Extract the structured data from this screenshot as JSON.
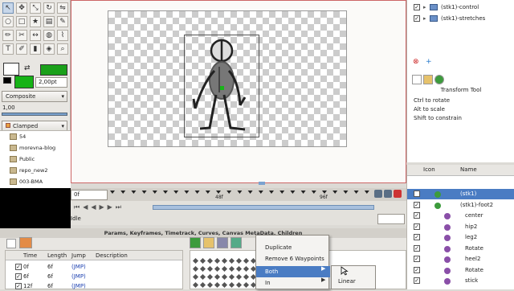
{
  "toolbox": {
    "tools": [
      "arrow",
      "smooth-move",
      "scale",
      "rotate",
      "mirror",
      "circle",
      "rectangle",
      "star",
      "gradient",
      "spline",
      "draw",
      "cutout",
      "width",
      "fill",
      "eyedrop",
      "text",
      "sketch",
      "brush",
      "bone",
      "zoom"
    ],
    "outline_color": "#1aa01a",
    "fill_color": "#16b316",
    "width_value": "2,00pt",
    "blend_method": "Composite",
    "opacity_value": "1,00",
    "interpolation": "Clamped"
  },
  "files": {
    "items": [
      "54",
      "morevna-blog",
      "Public",
      "repo_new2",
      "003-BMA"
    ]
  },
  "layers_top": {
    "rows": [
      {
        "label": "(stk1)-control",
        "checked": true
      },
      {
        "label": "(stk1)-stretches",
        "checked": true
      }
    ]
  },
  "tool_options": {
    "title": "Transform Tool",
    "lines": [
      "Ctrl to rotate",
      "Alt to scale",
      "Shift to constrain"
    ]
  },
  "timebar": {
    "current_frame": "0f",
    "tick_labels": [
      "48f",
      "96f"
    ]
  },
  "status": {
    "text": "Idle"
  },
  "bottom_panel": {
    "title": "Params, Keyframes, Timetrack, Curves, Canvas MetaData, Children",
    "columns": [
      "Time",
      "Length",
      "Jump",
      "Description"
    ],
    "rows": [
      {
        "time": "0f",
        "length": "6f",
        "jump": "(JMP)"
      },
      {
        "time": "6f",
        "length": "6f",
        "jump": "(JMP)"
      },
      {
        "time": "12f",
        "length": "6f",
        "jump": "(JMP)"
      }
    ]
  },
  "context_menu": {
    "items": [
      "Duplicate",
      "Remove 6 Waypoints",
      "Both",
      "In"
    ],
    "highlighted": "Both",
    "submenu": [
      "Linear"
    ]
  },
  "params": {
    "columns": [
      "Icon",
      "Name"
    ],
    "rows": [
      {
        "name": "(stk1)",
        "selected": true
      },
      {
        "name": "(stk1)-foot2"
      },
      {
        "name": "center"
      },
      {
        "name": "hip2"
      },
      {
        "name": "leg2"
      },
      {
        "name": "Rotate"
      },
      {
        "name": "heel2"
      },
      {
        "name": "Rotate"
      },
      {
        "name": "stick"
      }
    ]
  }
}
